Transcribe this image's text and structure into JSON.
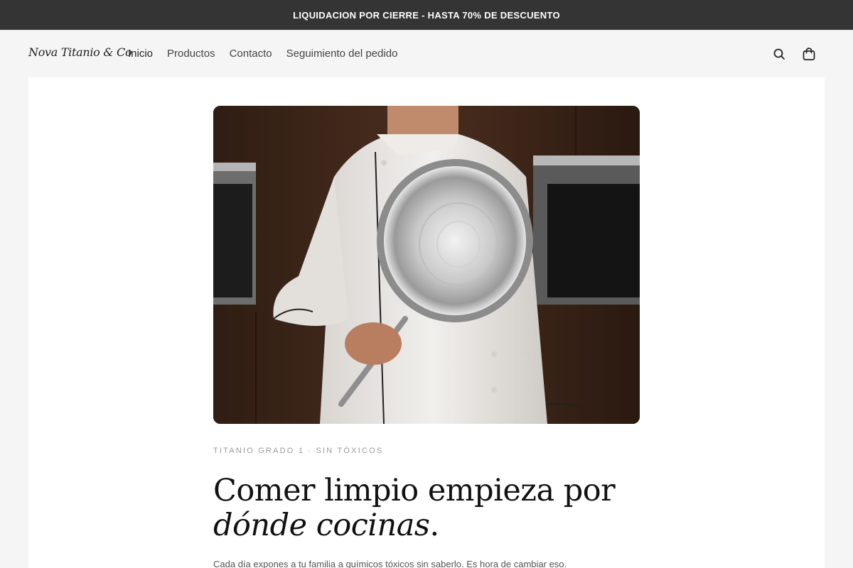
{
  "announcement": {
    "text": "LIQUIDACION POR CIERRE - HASTA 70% DE DESCUENTO"
  },
  "header": {
    "logo_text": "Nova Titanio & Co",
    "nav": [
      {
        "label": "Inicio"
      },
      {
        "label": "Productos"
      },
      {
        "label": "Contacto"
      },
      {
        "label": "Seguimiento del pedido"
      }
    ],
    "icons": {
      "search": "search-icon",
      "cart": "shopping-bag-icon"
    }
  },
  "hero": {
    "eyebrow": "TITANIO GRADO 1 · SIN TÓXICOS",
    "headline_plain": "Comer limpio empieza por ",
    "headline_italic": "dónde cocinas",
    "headline_end": ".",
    "subtext": "Cada día expones a tu familia a químicos tóxicos sin saberlo. Es hora de cambiar eso."
  },
  "colors": {
    "announcement_bg": "#343434",
    "page_bg": "#f5f5f5",
    "content_bg": "#ffffff",
    "kitchen_wood": "#3a2519"
  }
}
